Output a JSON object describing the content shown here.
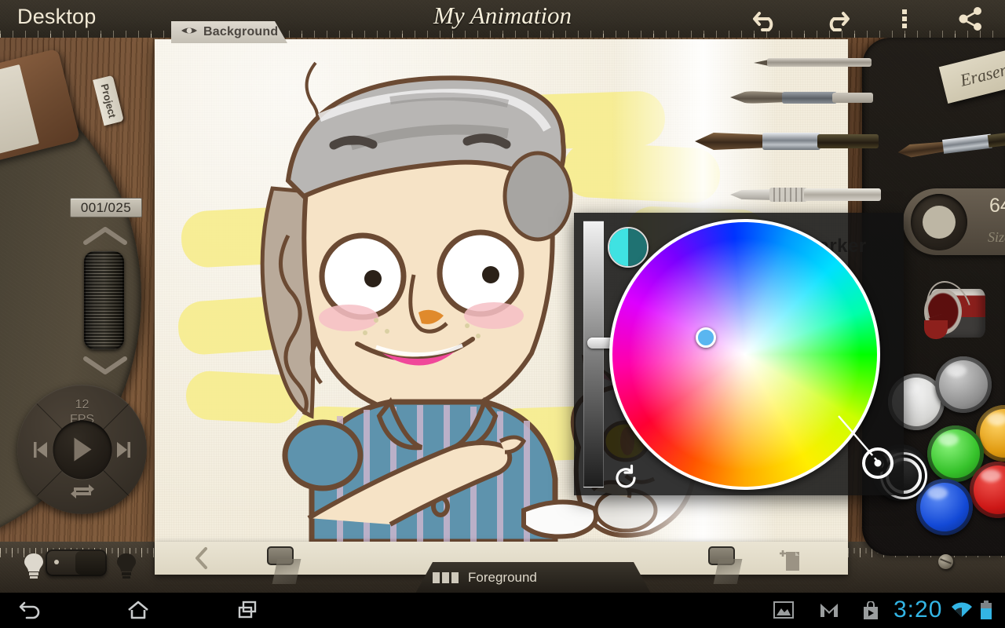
{
  "topbar": {
    "desktop_label": "Desktop",
    "app_title": "My Animation",
    "background_tab_label": "Background",
    "icons": {
      "undo": "undo-icon",
      "redo": "redo-icon",
      "overflow": "overflow-menu-icon",
      "share": "share-icon",
      "eye": "eye-icon"
    }
  },
  "left_console": {
    "project_tab_label": "Project",
    "frame_counter": "001/025",
    "frame_up": "chevron-up-icon",
    "frame_down": "chevron-down-icon",
    "fps_value": "12",
    "fps_unit": "FPS",
    "playback": {
      "play": "play-icon",
      "previous": "skip-previous-icon",
      "next": "skip-next-icon",
      "loop": "loop-icon"
    }
  },
  "canvas_foot": {
    "back_label": "‹",
    "add_frame_label": "add-frame-icon",
    "layer_tab_label": "Foreground"
  },
  "right_panel": {
    "eraser_label": "Eraser",
    "marker_label": "Marker",
    "size_value": "64",
    "size_label": "Size",
    "tools": [
      {
        "name": "pencil",
        "label": "Pencil"
      },
      {
        "name": "brush-small",
        "label": "Small Brush"
      },
      {
        "name": "brush-large",
        "label": "Large Brush"
      },
      {
        "name": "pen",
        "label": "Pen"
      },
      {
        "name": "marker",
        "label": "Marker"
      },
      {
        "name": "eraser",
        "label": "Eraser"
      },
      {
        "name": "paint-bucket",
        "label": "Fill"
      }
    ],
    "palette": [
      {
        "name": "white",
        "color": "#e9e9e9",
        "selected": false
      },
      {
        "name": "gray",
        "color": "#9a9a9a",
        "selected": false
      },
      {
        "name": "orange",
        "color": "#e09a10",
        "selected": false
      },
      {
        "name": "green",
        "color": "#36c22b",
        "selected": false
      },
      {
        "name": "red",
        "color": "#cc1716",
        "selected": false
      },
      {
        "name": "blue",
        "color": "#1349d6",
        "selected": false
      },
      {
        "name": "black",
        "color": "#121212",
        "selected": true
      }
    ]
  },
  "color_picker": {
    "current_color": "#3fe2e2",
    "previous_color": "#1f7272",
    "selected_color": "#5ab6f0",
    "brightness_value": 62,
    "reset_label": "reset-icon"
  },
  "bottom_bar": {
    "onion_skin_on": true,
    "bulb_on_label": "bulb-on-icon",
    "bulb_off_label": "bulb-off-icon"
  },
  "system_bar": {
    "back": "back-icon",
    "home": "home-icon",
    "recents": "recents-icon",
    "gallery": "gallery-icon",
    "mail": "gmail-icon",
    "play_store": "play-store-icon",
    "clock": "3:20",
    "wifi": "wifi-icon",
    "battery": "battery-icon"
  },
  "colors": {
    "accent_cyan": "#33b5e5",
    "paper": "#f3eddd",
    "wood": "#7c5737",
    "panel_dark": "#1a1713",
    "title_cream": "#f5eeda"
  }
}
